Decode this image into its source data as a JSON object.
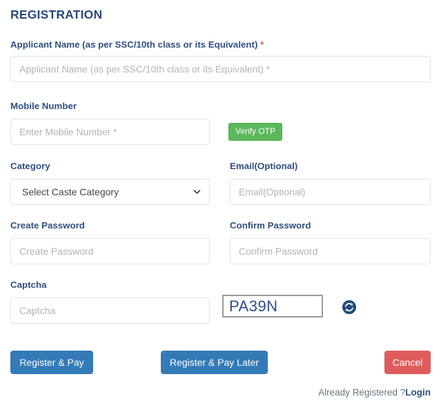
{
  "page": {
    "title": "REGISTRATION"
  },
  "colors": {
    "title": "#2a4a7c",
    "label": "#2f4f80",
    "required_star": "#d9534f",
    "primary_button": "#337ab7",
    "success_button": "#5cb85c",
    "danger_button": "#e05c5c",
    "captcha_text": "#2c4a88",
    "refresh_icon": "#1f4e79",
    "placeholder": "#b0b0b0"
  },
  "fields": {
    "applicant_name": {
      "label": "Applicant Name (as per SSC/10th class or its Equivalent)",
      "required_marker": "*",
      "placeholder": "Applicant Name (as per SSC/10th class or its Equivalent) *",
      "value": ""
    },
    "mobile_number": {
      "label": "Mobile Number",
      "placeholder": "Enter Mobile Number *",
      "value": ""
    },
    "category": {
      "label": "Category",
      "selected": "Select Caste Category",
      "options": [
        "Select Caste Category"
      ]
    },
    "email": {
      "label": "Email(Optional)",
      "placeholder": "Email(Optional)",
      "value": ""
    },
    "create_password": {
      "label": "Create Password",
      "placeholder": "Create Password",
      "value": ""
    },
    "confirm_password": {
      "label": "Confirm Password",
      "placeholder": "Confirm Password",
      "value": ""
    },
    "captcha": {
      "label": "Captcha",
      "placeholder": "Captcha",
      "value": "",
      "image_text": "PA39N",
      "refresh_icon": "refresh-icon"
    }
  },
  "buttons": {
    "verify_otp": "Verify OTP",
    "register_pay": "Register & Pay",
    "register_pay_later": "Register & Pay Later",
    "cancel": "Cancel"
  },
  "footer": {
    "already_registered": "Already Registered ?",
    "login_link": "Login"
  }
}
